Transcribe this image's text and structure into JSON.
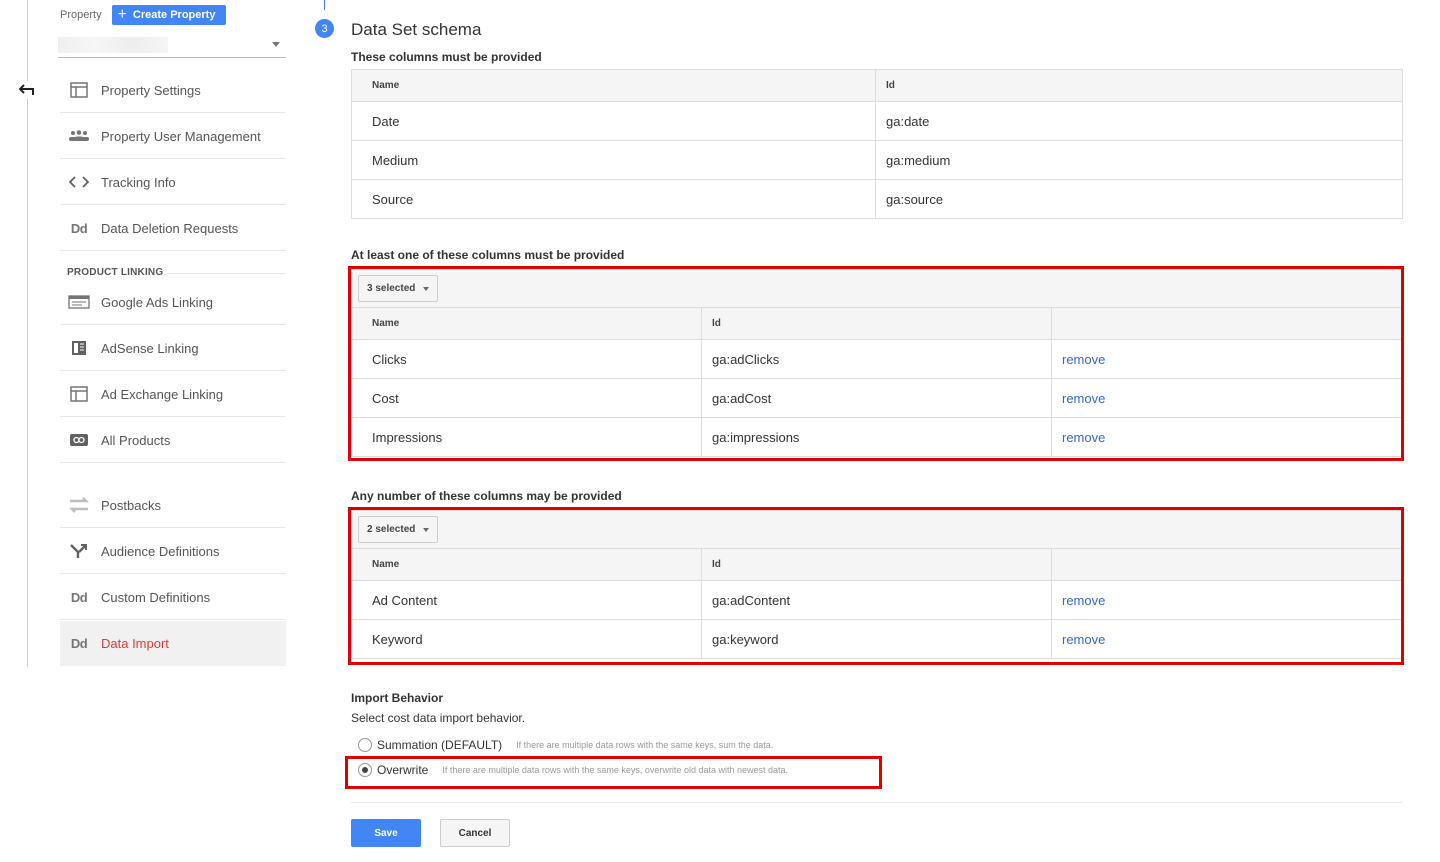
{
  "property": {
    "label": "Property",
    "create_label": "Create Property"
  },
  "sidebar": {
    "items": [
      {
        "label": "Property Settings"
      },
      {
        "label": "Property User Management"
      },
      {
        "label": "Tracking Info"
      },
      {
        "label": "Data Deletion Requests",
        "icon_text": "Dd"
      }
    ],
    "section_label": "PRODUCT LINKING",
    "linking_items": [
      {
        "label": "Google Ads Linking"
      },
      {
        "label": "AdSense Linking"
      },
      {
        "label": "Ad Exchange Linking"
      },
      {
        "label": "All Products"
      }
    ],
    "other_items": [
      {
        "label": "Postbacks"
      },
      {
        "label": "Audience Definitions"
      },
      {
        "label": "Custom Definitions",
        "icon_text": "Dd"
      },
      {
        "label": "Data Import",
        "icon_text": "Dd",
        "active": true
      }
    ]
  },
  "schema": {
    "step_number": "3",
    "title": "Data Set schema",
    "required": {
      "heading": "These columns must be provided",
      "headers": [
        "Name",
        "Id"
      ],
      "rows": [
        {
          "name": "Date",
          "id": "ga:date"
        },
        {
          "name": "Medium",
          "id": "ga:medium"
        },
        {
          "name": "Source",
          "id": "ga:source"
        }
      ]
    },
    "at_least_one": {
      "heading": "At least one of these columns must be provided",
      "selected_label": "3 selected",
      "headers": [
        "Name",
        "Id"
      ],
      "remove_label": "remove",
      "rows": [
        {
          "name": "Clicks",
          "id": "ga:adClicks"
        },
        {
          "name": "Cost",
          "id": "ga:adCost"
        },
        {
          "name": "Impressions",
          "id": "ga:impressions"
        }
      ]
    },
    "any_number": {
      "heading": "Any number of these columns may be provided",
      "selected_label": "2 selected",
      "headers": [
        "Name",
        "Id"
      ],
      "remove_label": "remove",
      "rows": [
        {
          "name": "Ad Content",
          "id": "ga:adContent"
        },
        {
          "name": "Keyword",
          "id": "ga:keyword"
        }
      ]
    }
  },
  "import_behavior": {
    "title": "Import Behavior",
    "description": "Select cost data import behavior.",
    "options": [
      {
        "label": "Summation (DEFAULT)",
        "desc": "If there are multiple data rows with the same keys, sum the data.",
        "checked": false
      },
      {
        "label": "Overwrite",
        "desc": "If there are multiple data rows with the same keys, overwrite old data with newest data.",
        "checked": true
      }
    ]
  },
  "actions": {
    "save": "Save",
    "cancel": "Cancel"
  },
  "colors": {
    "accent": "#4285f4",
    "link": "#3367d6",
    "active_nav": "#e53935",
    "highlight": "#e00000"
  }
}
